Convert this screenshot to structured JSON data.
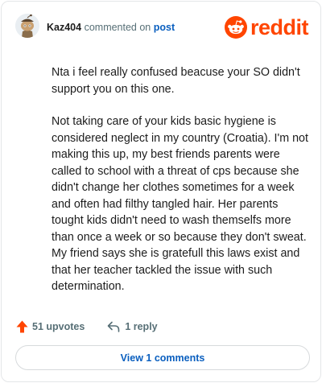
{
  "comment": {
    "username": "Kaz404",
    "action_text": "commented on",
    "post_link": "post",
    "paragraphs": [
      "Nta i feel really confused beacuse your SO didn't support you on this one.",
      "Not taking care of your kids basic hygiene is considered neglect in my country (Croatia). I'm not making this up, my best friends parents were called to school with a threat of cps because she didn't change her clothes sometimes for a week and often had filthy tangled hair. Her parents tought kids didn't need to wash themselfs more than once a week or so because they don't sweat. My friend says she is gratefull this laws exist and that her teacher tackled the issue with such determination."
    ],
    "upvotes_label": "51 upvotes",
    "reply_label": "1 reply",
    "view_comments_label": "View 1 comments"
  },
  "brand": {
    "logo_text": "reddit",
    "logo_icon": "reddit-snoo-icon",
    "accent": "#ff4500",
    "link_color": "#0a5fbf",
    "muted_text": "#576f76"
  },
  "icons": {
    "avatar": "snoo-avatar-icon",
    "upvote": "upvote-arrow-icon",
    "reply": "reply-arrow-icon"
  }
}
